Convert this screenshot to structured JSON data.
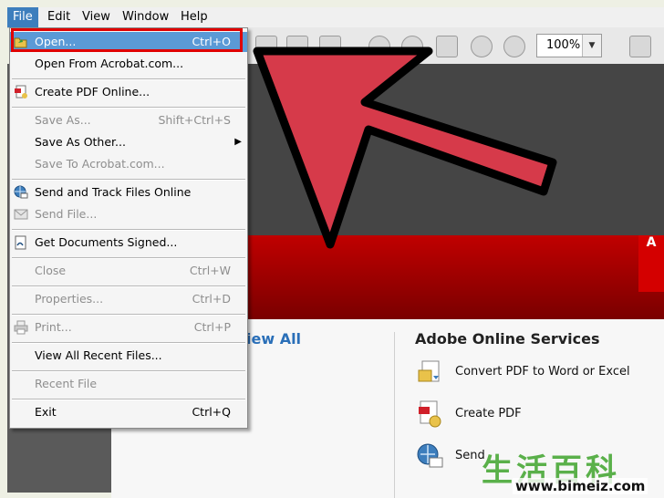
{
  "menubar": {
    "items": [
      "File",
      "Edit",
      "View",
      "Window",
      "Help"
    ]
  },
  "toolbar": {
    "zoom": "100%"
  },
  "file_menu": {
    "items": [
      {
        "label": "Open...",
        "shortcut": "Ctrl+O",
        "highlighted": true,
        "icon": "open-folder-icon"
      },
      {
        "label": "Open From Acrobat.com...",
        "shortcut": ""
      },
      {
        "label": "Create PDF Online...",
        "shortcut": "",
        "icon": "create-pdf-icon"
      },
      {
        "label": "Save As...",
        "shortcut": "Shift+Ctrl+S",
        "disabled": true
      },
      {
        "label": "Save As Other...",
        "shortcut": "",
        "submenu": true
      },
      {
        "label": "Save To Acrobat.com...",
        "shortcut": "",
        "disabled": true
      },
      {
        "label": "Send and Track Files Online",
        "shortcut": "",
        "icon": "globe-icon"
      },
      {
        "label": "Send File...",
        "shortcut": "",
        "disabled": true,
        "icon": "envelope-icon"
      },
      {
        "label": "Get Documents Signed...",
        "shortcut": "",
        "icon": "sign-icon"
      },
      {
        "label": "Close",
        "shortcut": "Ctrl+W",
        "disabled": true
      },
      {
        "label": "Properties...",
        "shortcut": "Ctrl+D",
        "disabled": true
      },
      {
        "label": "Print...",
        "shortcut": "Ctrl+P",
        "disabled": true,
        "icon": "printer-icon"
      },
      {
        "label": "View All Recent Files...",
        "shortcut": ""
      },
      {
        "label": "Recent File",
        "shortcut": "",
        "disabled": true
      },
      {
        "label": "Exit",
        "shortcut": "Ctrl+Q"
      }
    ]
  },
  "welcome": {
    "view_all": "iew All",
    "services_title": "Adobe Online Services",
    "services": [
      {
        "label": "Convert PDF to Word or Excel",
        "icon": "convert-icon"
      },
      {
        "label": "Create PDF",
        "icon": "create-pdf-icon"
      },
      {
        "label": "Send",
        "icon": "send-icon"
      }
    ]
  },
  "watermark": {
    "chinese": "生活百科",
    "url": "www.bimeiz.com"
  },
  "colors": {
    "highlight": "#5b9ad6",
    "arrow": "#d63a4a",
    "callout": "#e00000"
  }
}
